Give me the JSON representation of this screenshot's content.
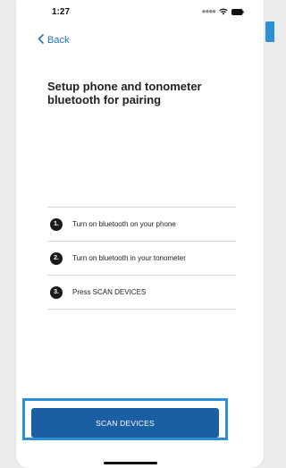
{
  "status_bar": {
    "time": "1:27",
    "signal_icon": "signal-dots-icon",
    "wifi_icon": "wifi-icon",
    "battery_icon": "battery-icon"
  },
  "nav": {
    "back_label": "Back",
    "back_icon": "chevron-left-icon"
  },
  "title": "Setup phone and tonometer bluetooth for pairing",
  "steps": [
    {
      "number": "1.",
      "text": "Turn on bluetooth on your phone"
    },
    {
      "number": "2.",
      "text": "Turn on bluetooth in your tonometer"
    },
    {
      "number": "3.",
      "text": "Press SCAN DEVICES"
    }
  ],
  "scan_button": {
    "label": "SCAN DEVICES"
  },
  "colors": {
    "accent": "#2d8fd5",
    "button": "#1a5fa3",
    "link": "#1f6fc7",
    "background": "#ececec"
  }
}
